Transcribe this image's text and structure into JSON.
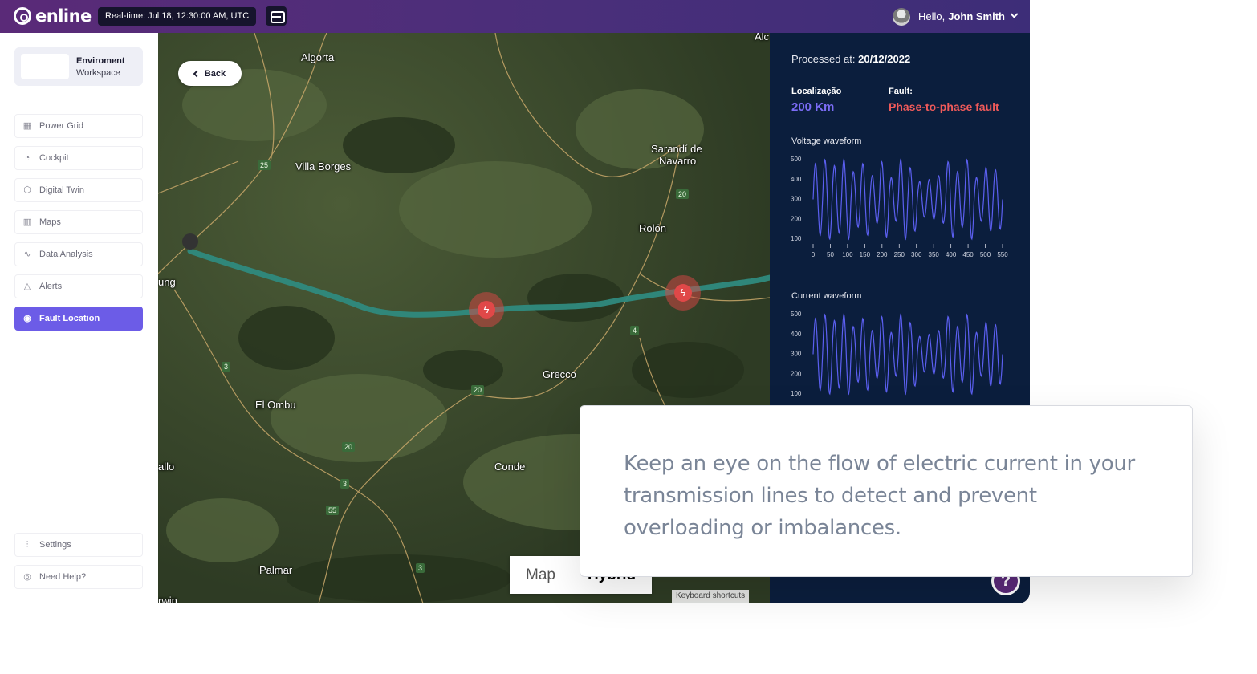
{
  "app": {
    "logo_text": "enline",
    "realtime": "Real-time: Jul 18, 12:30:00 AM, UTC",
    "greeting": "Hello,",
    "user_name": "John Smith"
  },
  "sidebar": {
    "workspace_title": "Enviroment",
    "workspace_sub": "Workspace",
    "items": [
      {
        "label": "Power Grid",
        "icon": "grid-icon"
      },
      {
        "label": "Cockpit",
        "icon": "gauge-icon"
      },
      {
        "label": "Digital Twin",
        "icon": "cube-icon"
      },
      {
        "label": "Maps",
        "icon": "map-icon"
      },
      {
        "label": "Data Analysis",
        "icon": "pulse-icon"
      },
      {
        "label": "Alerts",
        "icon": "warning-icon"
      },
      {
        "label": "Fault Location",
        "icon": "signal-icon",
        "active": true
      }
    ],
    "bottom_items": [
      {
        "label": "Settings",
        "icon": "sliders-icon"
      },
      {
        "label": "Need Help?",
        "icon": "help-icon"
      }
    ]
  },
  "map": {
    "back_label": "Back",
    "places": [
      "Algorta",
      "Villa Borges",
      "Sarandí de",
      "Navarro",
      "Rolón",
      "ung",
      "Grecco",
      "El Ombu",
      "allo",
      "Conde",
      "Palmar",
      "rwin",
      "Alc"
    ],
    "road_badges": [
      "25",
      "20",
      "3",
      "4",
      "20",
      "20",
      "3",
      "55",
      "3"
    ],
    "toggle": [
      "Map",
      "Hybrid"
    ],
    "keyboard_shortcuts": "Keyboard shortcuts"
  },
  "panel": {
    "processed_label": "Processed at:",
    "processed_date": "20/12/2022",
    "location_label": "Localização",
    "location_value": "200  Km",
    "fault_label": "Fault:",
    "fault_value": "Phase-to-phase fault",
    "voltage_title": "Voltage waveform",
    "current_title": "Current waveform",
    "help_symbol": "?"
  },
  "chart_data": [
    {
      "type": "line",
      "title": "Voltage waveform",
      "ytick_labels": [
        "500",
        "400",
        "300",
        "200",
        "100"
      ],
      "xtick_labels": [
        "0",
        "50",
        "100",
        "150",
        "200",
        "250",
        "300",
        "350",
        "400",
        "450",
        "500",
        "550"
      ],
      "xlim": [
        0,
        550
      ],
      "ylim": [
        100,
        500
      ],
      "color": "#5b5ff0"
    },
    {
      "type": "line",
      "title": "Current waveform",
      "ytick_labels": [
        "500",
        "400",
        "300",
        "200",
        "100"
      ],
      "xlim": [
        0,
        550
      ],
      "ylim": [
        100,
        500
      ],
      "color": "#5b5ff0"
    }
  ],
  "tooltip": {
    "text": "Keep an eye on the flow of electric current in your transmission lines to detect and prevent overloading or imbalances."
  },
  "colors": {
    "accent": "#6c5ce7",
    "panel_bg": "#0b1e3d",
    "fault": "#f05a5a",
    "line": "#2f8a7e"
  }
}
